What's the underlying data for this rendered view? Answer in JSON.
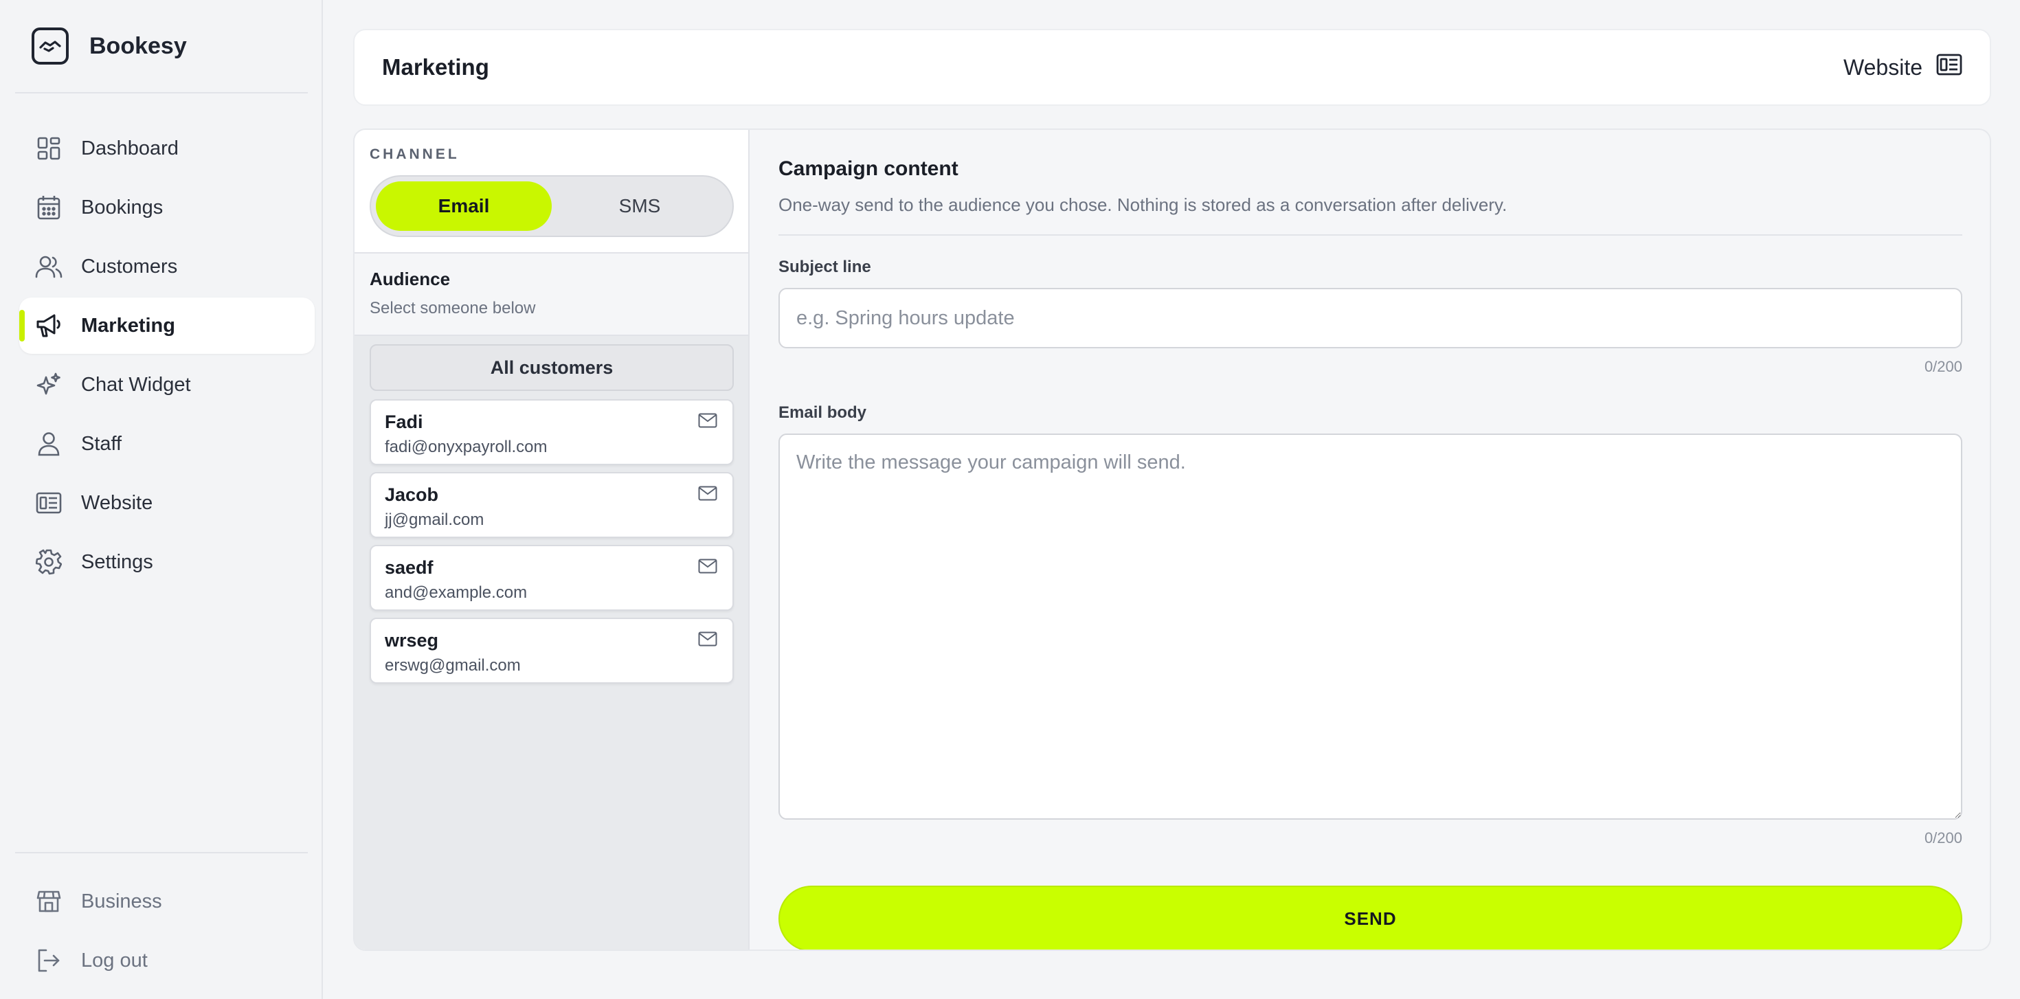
{
  "brand": {
    "name": "Bookesy",
    "logo_icon": "handshake-logo-icon"
  },
  "sidebar": {
    "items": [
      {
        "label": "Dashboard",
        "icon": "dashboard-grid-icon"
      },
      {
        "label": "Bookings",
        "icon": "calendar-icon"
      },
      {
        "label": "Customers",
        "icon": "users-icon"
      },
      {
        "label": "Marketing",
        "icon": "megaphone-icon",
        "active": true
      },
      {
        "label": "Chat Widget",
        "icon": "sparkles-icon"
      },
      {
        "label": "Staff",
        "icon": "user-icon"
      },
      {
        "label": "Website",
        "icon": "website-layout-icon"
      },
      {
        "label": "Settings",
        "icon": "gear-icon"
      }
    ],
    "bottom_items": [
      {
        "label": "Business",
        "icon": "store-icon"
      },
      {
        "label": "Log out",
        "icon": "logout-icon"
      }
    ],
    "accent_color": "#c9f000"
  },
  "header": {
    "title": "Marketing",
    "website_label": "Website"
  },
  "channel": {
    "label": "CHANNEL",
    "options": [
      "Email",
      "SMS"
    ],
    "selected": "Email"
  },
  "audience": {
    "title": "Audience",
    "subtitle": "Select someone below",
    "all_label": "All customers",
    "customers": [
      {
        "name": "Fadi",
        "email": "fadi@onyxpayroll.com"
      },
      {
        "name": "Jacob",
        "email": "jj@gmail.com"
      },
      {
        "name": "saedf",
        "email": "and@example.com"
      },
      {
        "name": "wrseg",
        "email": "erswg@gmail.com"
      }
    ]
  },
  "campaign": {
    "title": "Campaign content",
    "subtitle": "One-way send to the audience you chose. Nothing is stored as a conversation after delivery.",
    "subject_label": "Subject line",
    "subject_placeholder": "e.g. Spring hours update",
    "subject_value": "",
    "subject_counter": "0/200",
    "body_label": "Email body",
    "body_placeholder": "Write the message your campaign will send.",
    "body_value": "",
    "body_counter": "0/200",
    "send_label": "SEND",
    "send_color": "#c9ff00"
  }
}
